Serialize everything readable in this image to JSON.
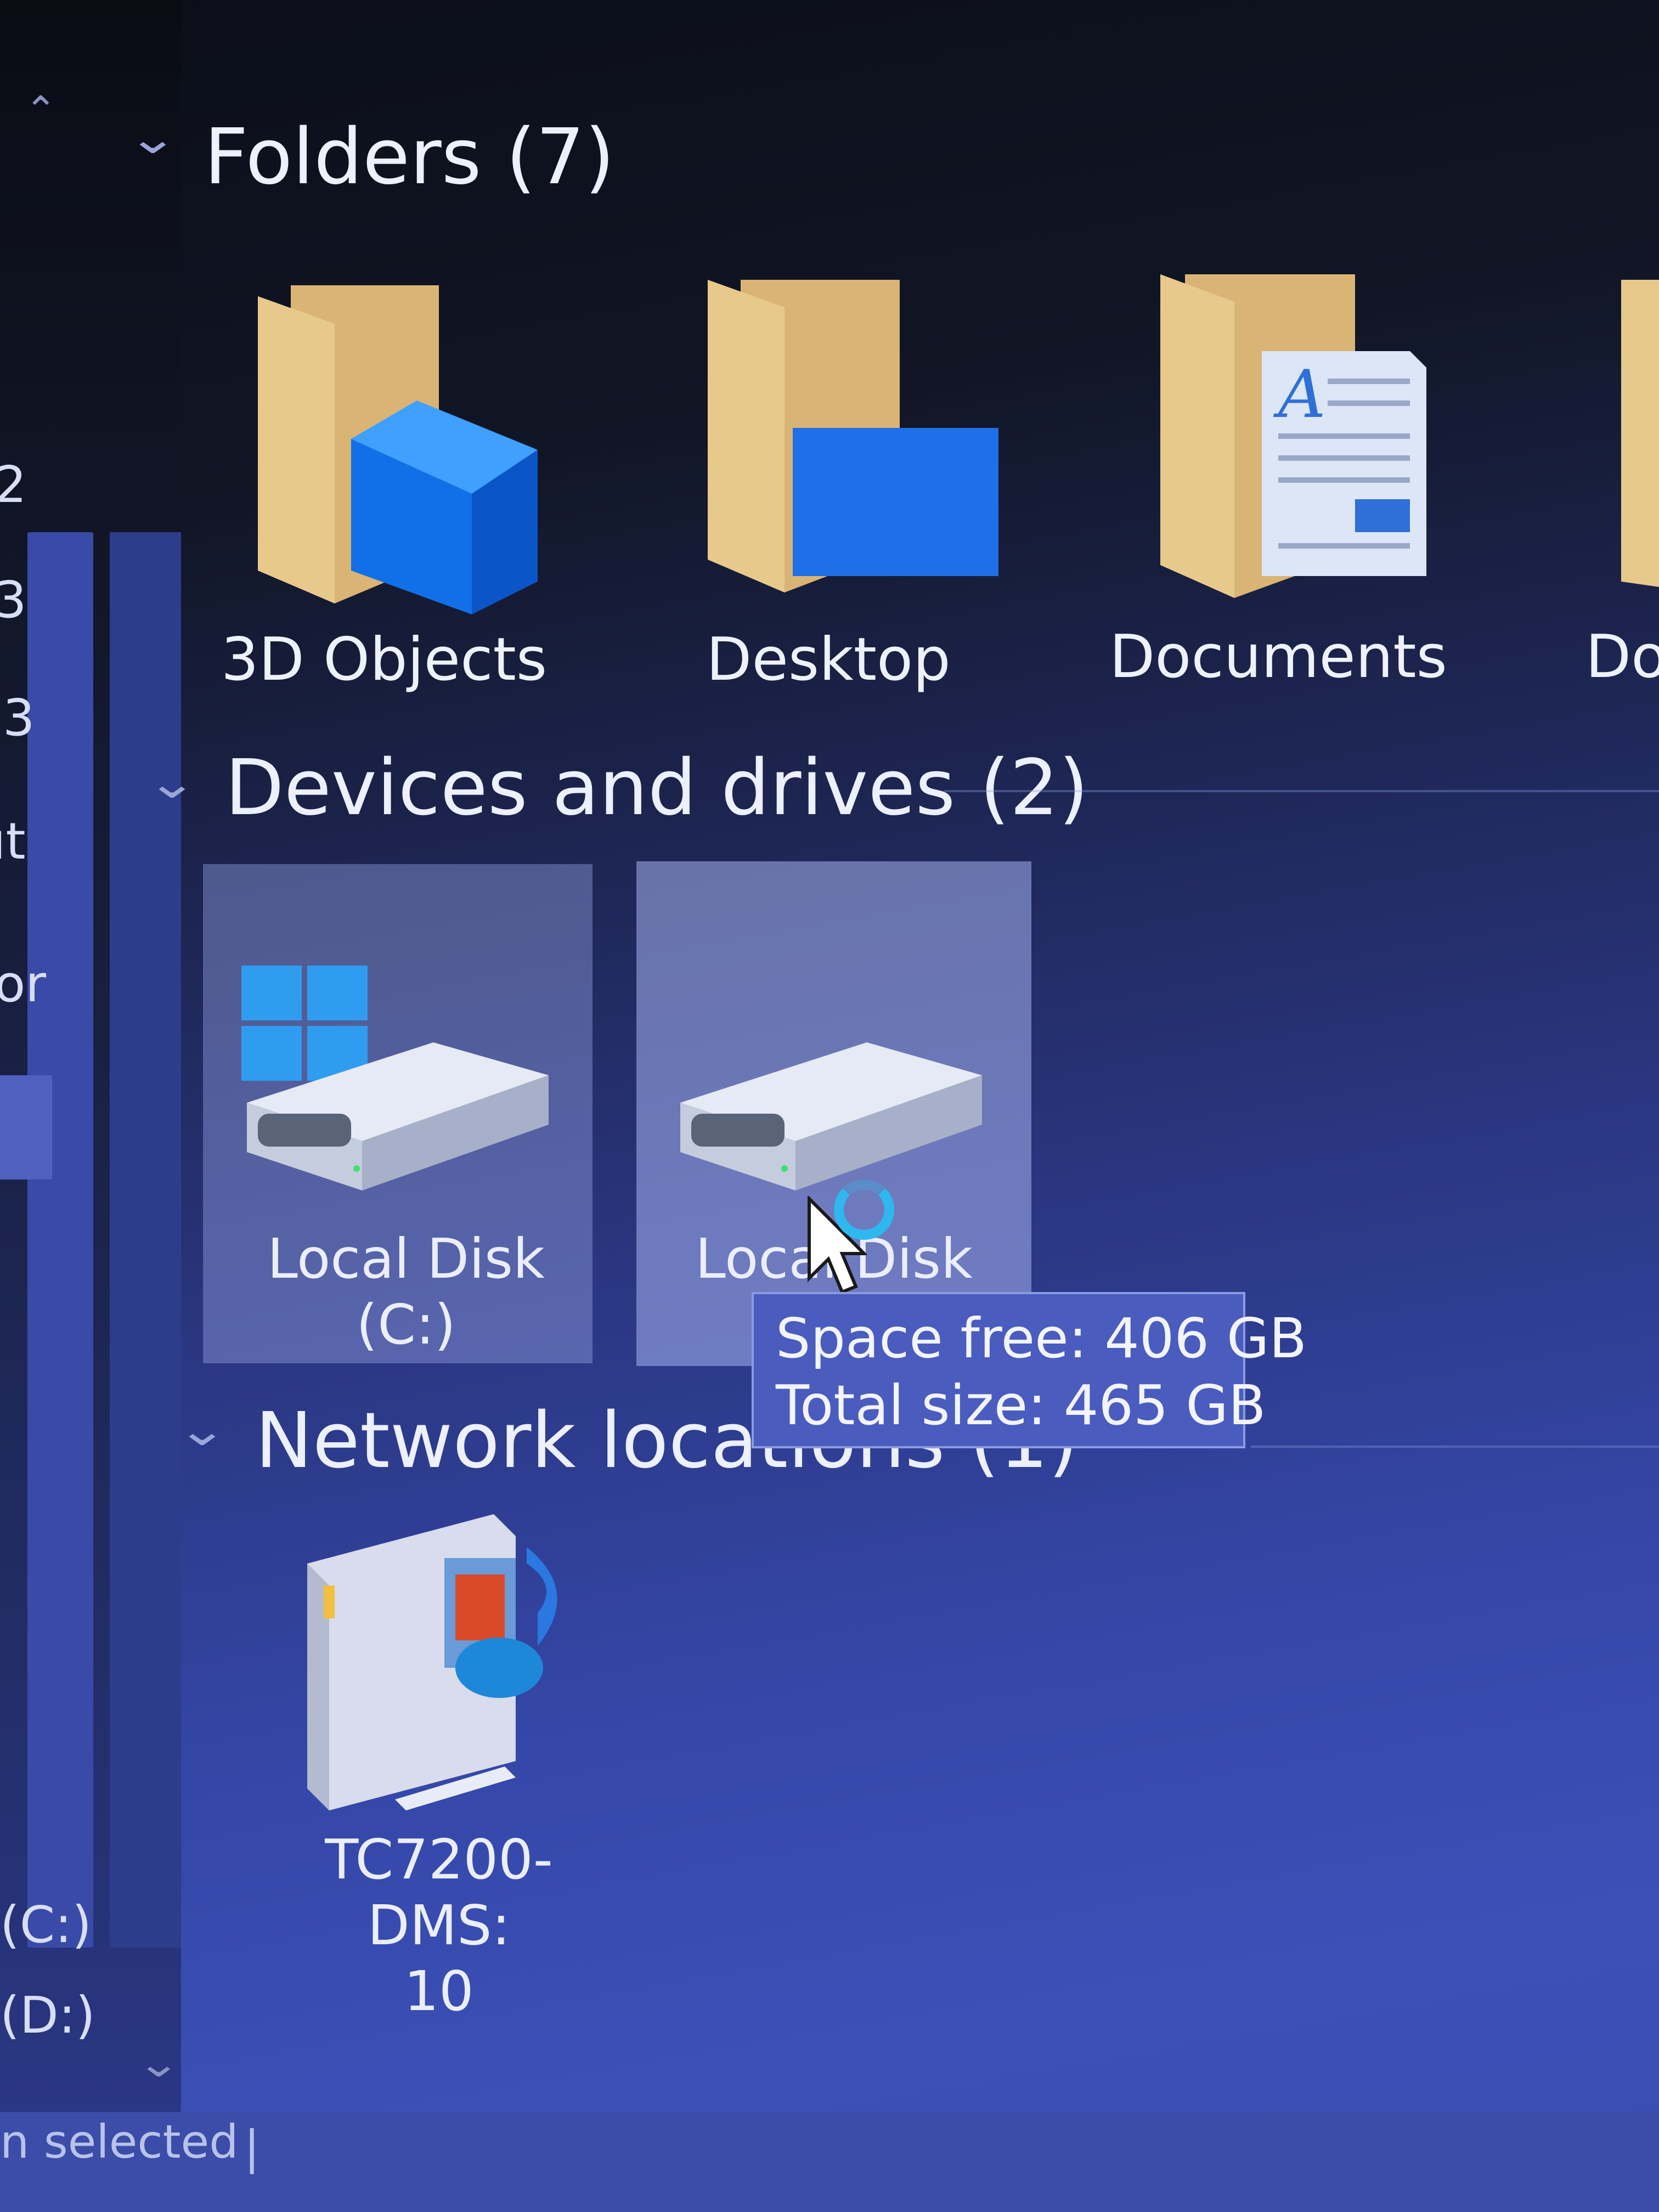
{
  "nav": {
    "visible_fragments": [
      "2",
      "3",
      "3",
      "ıt",
      "or"
    ],
    "drive_c": "(C:)",
    "drive_d": "(D:)"
  },
  "folders": {
    "title": "Folders (7)",
    "items": [
      {
        "label": "3D Objects",
        "icon": "3d-objects-folder-icon"
      },
      {
        "label": "Desktop",
        "icon": "desktop-folder-icon"
      },
      {
        "label": "Documents",
        "icon": "documents-folder-icon"
      },
      {
        "label": "Do",
        "icon": "downloads-folder-icon"
      }
    ]
  },
  "devices": {
    "title": "Devices and drives (2)",
    "items": [
      {
        "label_line1": "Local Disk",
        "label_line2": "(C:)",
        "icon": "windows-system-drive-icon"
      },
      {
        "label_line1": "Local Disk",
        "label_line2": "",
        "icon": "hard-drive-icon"
      }
    ]
  },
  "network": {
    "title": "Network locations (1)",
    "items": [
      {
        "label_line1": "TC7200-DMS:",
        "label_line2": "10",
        "icon": "media-server-icon"
      }
    ]
  },
  "tooltip": {
    "line1": "Space free: 406 GB",
    "line2": "Total size: 465 GB"
  },
  "status": {
    "text": "n selected"
  }
}
